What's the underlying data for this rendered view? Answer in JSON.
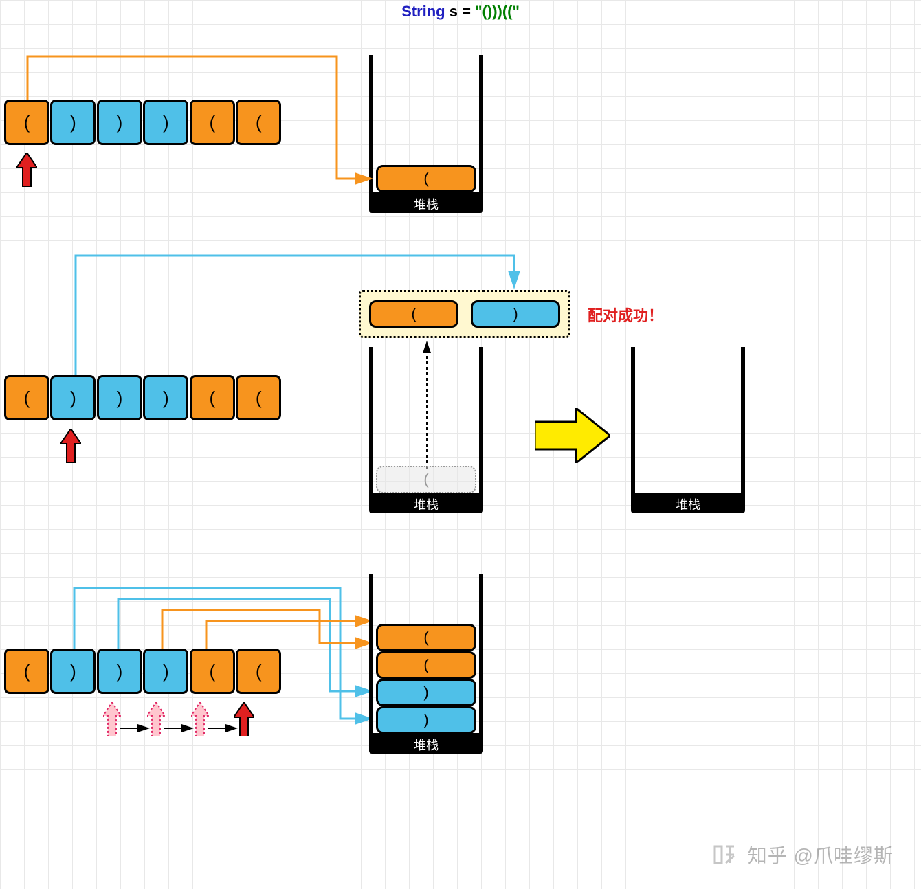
{
  "title": {
    "keyword": "String",
    "var": "s",
    "equals": "=",
    "value": "\"()))((\""
  },
  "sequence": [
    "(",
    ")",
    ")",
    ")",
    "(",
    "("
  ],
  "stackLabel": "堆栈",
  "panel1": {
    "stackItems": [
      "("
    ]
  },
  "panel2": {
    "pair": {
      "left": "(",
      "right": ")",
      "label": "配对成功！"
    },
    "ghost": "("
  },
  "panel3": {
    "stackItems": [
      "(",
      "(",
      ")",
      ")"
    ]
  },
  "watermark": "知乎 @爪哇缪斯",
  "colors": {
    "orange": "#f7941e",
    "blue": "#4fc0e8",
    "yellow": "#ffeb00",
    "red": "#e02020",
    "lineOrange": "#f7941e",
    "lineBlue": "#4fc0e8"
  }
}
